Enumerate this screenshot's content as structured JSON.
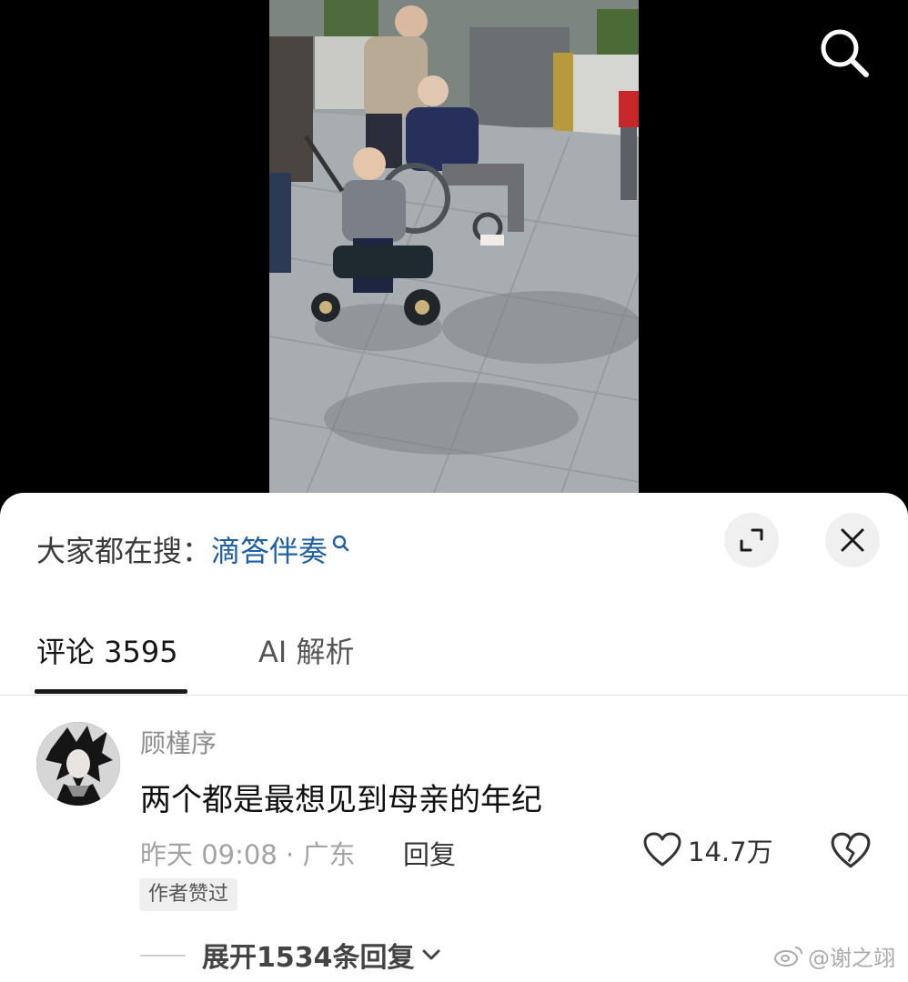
{
  "video": {
    "scene": "photo"
  },
  "header": {
    "search_icon": "search-icon"
  },
  "sheet": {
    "trending_prefix": "大家都在搜：",
    "trending_term": "滴答伴奏",
    "expand_icon": "expand-icon",
    "close_icon": "close-icon"
  },
  "tabs": [
    {
      "label": "评论 3595",
      "active": true
    },
    {
      "label": "AI 解析",
      "active": false
    }
  ],
  "comment": {
    "username": "顾槿序",
    "text": "两个都是最想见到母亲的年纪",
    "time_location": "昨天 09:08 · 广东",
    "reply_label": "回复",
    "like_count": "14.7万",
    "author_badge": "作者赞过"
  },
  "expand_replies": "展开1534条回复",
  "watermark": "@谢之翊",
  "colors": {
    "link": "#1f5fa3",
    "text": "#111111",
    "muted": "#a3a3a3",
    "accent_dark": "#1a1a1a"
  }
}
